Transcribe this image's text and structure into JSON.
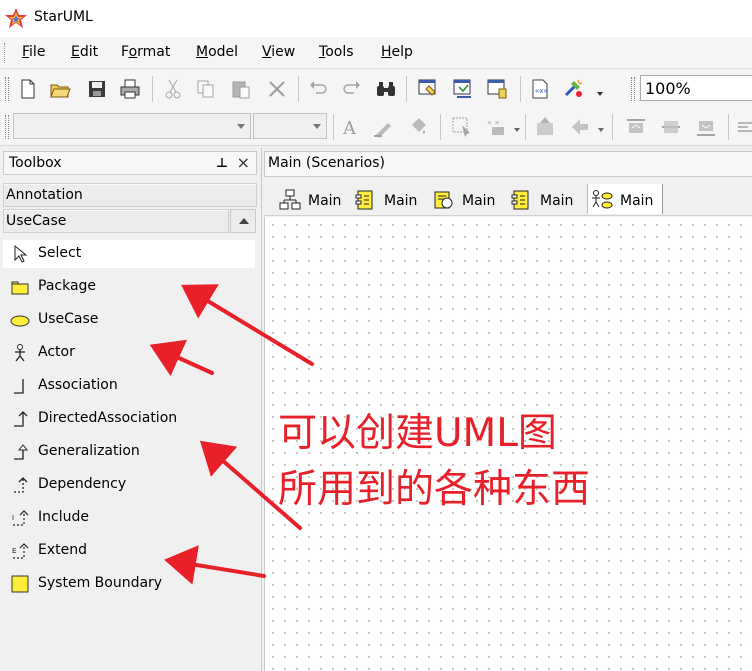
{
  "window": {
    "title": "StarUML",
    "logo_icon": "staruml-logo-icon"
  },
  "menu": [
    {
      "label": "File",
      "mnemonic": "F",
      "rest": "ile"
    },
    {
      "label": "Edit",
      "mnemonic": "E",
      "rest": "dit"
    },
    {
      "label": "Format",
      "mnemonic": "o",
      "pre": "F",
      "rest": "rmat"
    },
    {
      "label": "Model",
      "mnemonic": "M",
      "rest": "odel"
    },
    {
      "label": "View",
      "mnemonic": "V",
      "rest": "iew"
    },
    {
      "label": "Tools",
      "mnemonic": "T",
      "rest": "ools"
    },
    {
      "label": "Help",
      "mnemonic": "H",
      "rest": "elp"
    }
  ],
  "toolbar": {
    "zoom": "100%",
    "font_combo": "",
    "size_combo": ""
  },
  "toolbox": {
    "title": "Toolbox",
    "pin_icon": "pin-icon",
    "close_icon": "×",
    "groups": [
      "Annotation",
      "UseCase"
    ],
    "items": [
      {
        "label": "Select",
        "icon": "cursor-icon",
        "selected": true
      },
      {
        "label": "Package",
        "icon": "folder-icon"
      },
      {
        "label": "UseCase",
        "icon": "ellipse-icon"
      },
      {
        "label": "Actor",
        "icon": "actor-icon"
      },
      {
        "label": "Association",
        "icon": "association-icon"
      },
      {
        "label": "DirectedAssociation",
        "icon": "directed-association-icon"
      },
      {
        "label": "Generalization",
        "icon": "generalization-icon"
      },
      {
        "label": "Dependency",
        "icon": "dependency-icon"
      },
      {
        "label": "Include",
        "icon": "include-icon"
      },
      {
        "label": "Extend",
        "icon": "extend-icon"
      },
      {
        "label": "System Boundary",
        "icon": "system-boundary-icon"
      }
    ]
  },
  "diagram": {
    "title": "Main (Scenarios)",
    "tabs": [
      {
        "label": "Main",
        "icon": "class-diagram-icon"
      },
      {
        "label": "Main",
        "icon": "component-diagram-icon"
      },
      {
        "label": "Main",
        "icon": "deployment-diagram-icon"
      },
      {
        "label": "Main",
        "icon": "component-diagram-icon"
      },
      {
        "label": "Main",
        "icon": "usecase-diagram-icon",
        "active": true
      }
    ]
  },
  "annotation": {
    "line1": "可以创建UML图",
    "line2": "所用到的各种东西",
    "color": "#e8202a"
  }
}
